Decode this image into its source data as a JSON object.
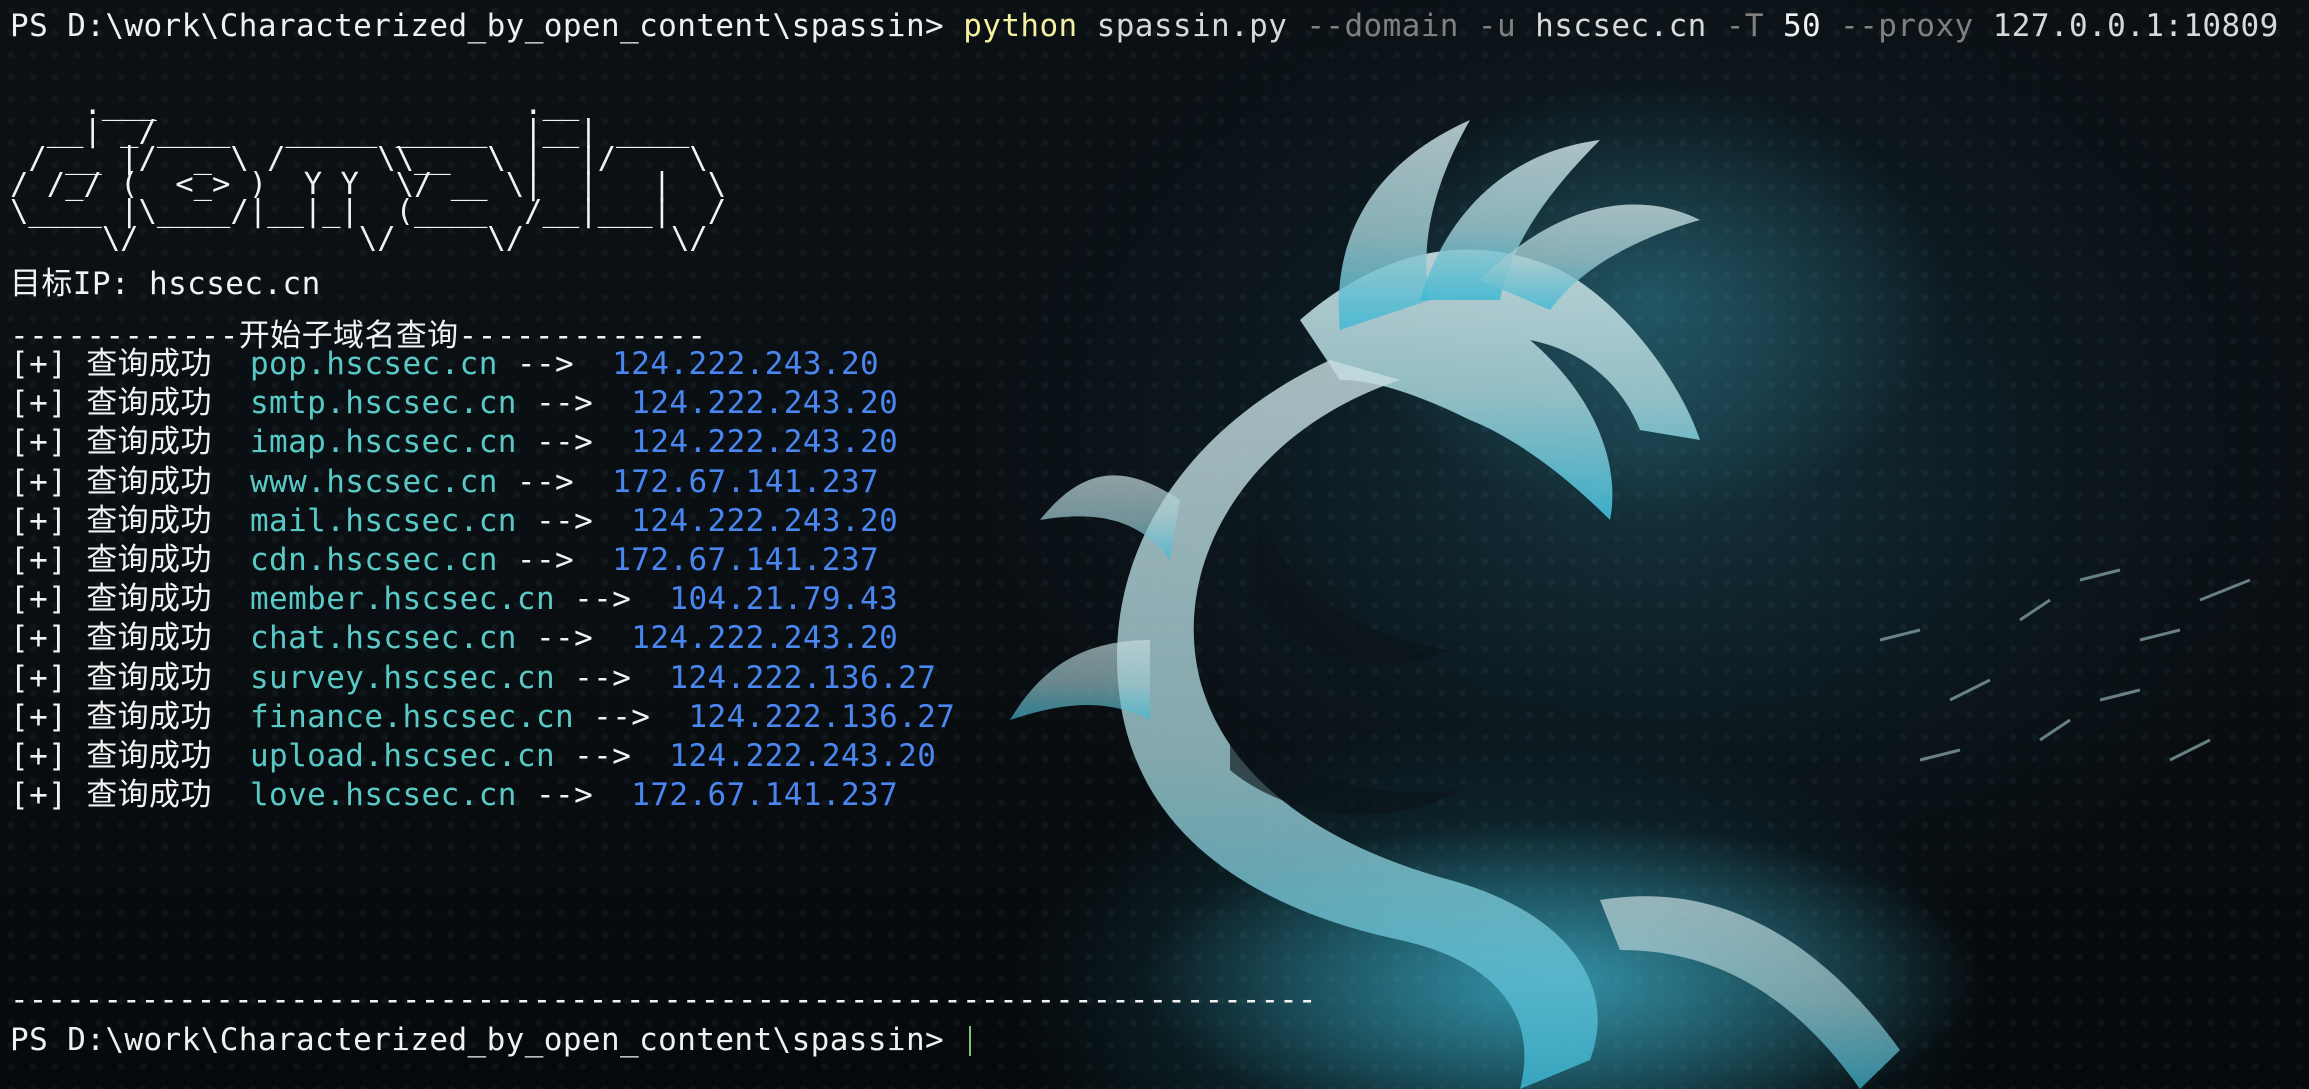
{
  "window": {
    "accent_domain_color": "#59c9c6",
    "accent_ip_color": "#4a86f0",
    "python_color": "#f5f0a0",
    "flag_color": "#808080"
  },
  "command": {
    "prompt": "PS D:\\work\\Characterized_by_open_content\\spassin> ",
    "program": "python",
    "script": " spassin.py ",
    "flag_domain": "--domain",
    "flag_u": " -u ",
    "target_arg": "hscsec.cn",
    "flag_T": " -T ",
    "threads": "50",
    "flag_proxy": " --proxy ",
    "proxy_value": "127.0.0.1:10809"
  },
  "banner": {
    "ascii_art": "    .___                    .__\n  __| _/____   _____ _____  |__| ____\n / __ |/  _ \\ /     \\\\__  \\ |  |/    \\\n/ /_/ (  <_> )  Y Y  \\/ __ \\|  |   |  \\\n\\____ |\\____/|__|_|  (____  /__|___|  /\n     \\/            \\/     \\/        \\/"
  },
  "target": {
    "label": "目标IP: hscsec.cn"
  },
  "section": {
    "header": "------------开始子域名查询-------------"
  },
  "results": [
    {
      "prefix": "[+] 查询成功  ",
      "domain": "pop.hscsec.cn",
      "arrow": " -->  ",
      "ip": "124.222.243.20"
    },
    {
      "prefix": "[+] 查询成功  ",
      "domain": "smtp.hscsec.cn",
      "arrow": " -->  ",
      "ip": "124.222.243.20"
    },
    {
      "prefix": "[+] 查询成功  ",
      "domain": "imap.hscsec.cn",
      "arrow": " -->  ",
      "ip": "124.222.243.20"
    },
    {
      "prefix": "[+] 查询成功  ",
      "domain": "www.hscsec.cn",
      "arrow": " -->  ",
      "ip": "172.67.141.237"
    },
    {
      "prefix": "[+] 查询成功  ",
      "domain": "mail.hscsec.cn",
      "arrow": " -->  ",
      "ip": "124.222.243.20"
    },
    {
      "prefix": "[+] 查询成功  ",
      "domain": "cdn.hscsec.cn",
      "arrow": " -->  ",
      "ip": "172.67.141.237"
    },
    {
      "prefix": "[+] 查询成功  ",
      "domain": "member.hscsec.cn",
      "arrow": " -->  ",
      "ip": "104.21.79.43"
    },
    {
      "prefix": "[+] 查询成功  ",
      "domain": "chat.hscsec.cn",
      "arrow": " -->  ",
      "ip": "124.222.243.20"
    },
    {
      "prefix": "[+] 查询成功  ",
      "domain": "survey.hscsec.cn",
      "arrow": " -->  ",
      "ip": "124.222.136.27"
    },
    {
      "prefix": "[+] 查询成功  ",
      "domain": "finance.hscsec.cn",
      "arrow": " -->  ",
      "ip": "124.222.136.27"
    },
    {
      "prefix": "[+] 查询成功  ",
      "domain": "upload.hscsec.cn",
      "arrow": " -->  ",
      "ip": "124.222.243.20"
    },
    {
      "prefix": "[+] 查询成功  ",
      "domain": "love.hscsec.cn",
      "arrow": " -->  ",
      "ip": "172.67.141.237"
    }
  ],
  "footer": {
    "divider": "----------------------------------------------------------------------",
    "prompt": "PS D:\\work\\Characterized_by_open_content\\spassin> "
  }
}
